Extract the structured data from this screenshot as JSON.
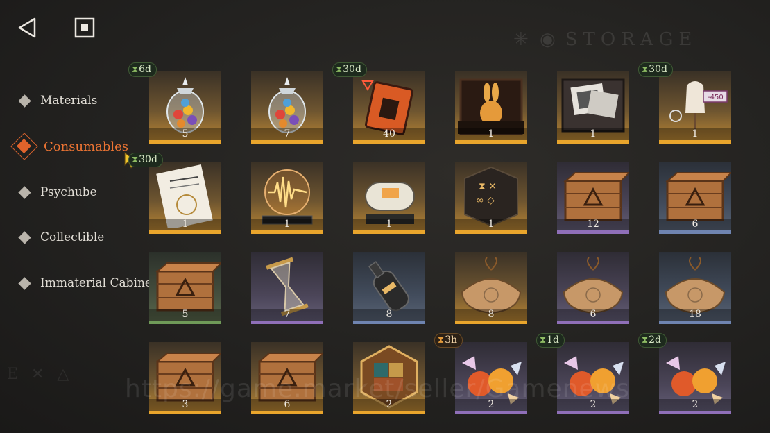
{
  "header": {
    "title": "STORAGE",
    "back_icon": "back-triangle-icon",
    "stop_icon": "stop-square-icon"
  },
  "sidebar": {
    "items": [
      {
        "label": "Materials",
        "active": false
      },
      {
        "label": "Consumables",
        "active": true
      },
      {
        "label": "Psychube",
        "active": false
      },
      {
        "label": "Collectible",
        "active": false
      },
      {
        "label": "Immaterial Cabinet",
        "active": false
      }
    ]
  },
  "colors": {
    "accent": "#e0632b",
    "rarity_gold": "#e9a52c",
    "rarity_purple": "#8f6fb8",
    "rarity_blue": "#6f84b0",
    "rarity_green": "#6f9a58",
    "timer_green": "#8dbb63",
    "timer_orange": "#e39a3b"
  },
  "items": [
    {
      "icon": "candy-jar-icon",
      "count": "5",
      "rarity": "gold",
      "timer": "6d",
      "timer_color": "green"
    },
    {
      "icon": "candy-jar-icon",
      "count": "7",
      "rarity": "gold",
      "timer": null
    },
    {
      "icon": "orange-book-icon",
      "count": "40",
      "rarity": "gold",
      "timer": "30d",
      "timer_color": "green"
    },
    {
      "icon": "golden-rabbit-box-icon",
      "count": "1",
      "rarity": "gold",
      "timer": null
    },
    {
      "icon": "photo-suitcase-icon",
      "count": "1",
      "rarity": "gold",
      "timer": null
    },
    {
      "icon": "mannequin-price-tag-icon",
      "count": "1",
      "rarity": "gold",
      "timer": "30d",
      "timer_color": "green"
    },
    {
      "icon": "ticket-note-icon",
      "count": "1",
      "rarity": "gold",
      "timer": "30d",
      "timer_color": "green"
    },
    {
      "icon": "sound-wave-orb-icon",
      "count": "1",
      "rarity": "gold",
      "timer": null
    },
    {
      "icon": "capsule-machine-icon",
      "count": "1",
      "rarity": "gold",
      "timer": null
    },
    {
      "icon": "rune-cube-icon",
      "count": "1",
      "rarity": "gold",
      "timer": null
    },
    {
      "icon": "wooden-crate-icon",
      "count": "12",
      "rarity": "purple",
      "timer": null
    },
    {
      "icon": "wooden-crate-icon",
      "count": "6",
      "rarity": "blue",
      "timer": null
    },
    {
      "icon": "wooden-crate-icon",
      "count": "5",
      "rarity": "green",
      "timer": null
    },
    {
      "icon": "hourglass-icon",
      "count": "7",
      "rarity": "purple",
      "timer": null
    },
    {
      "icon": "message-bottle-icon",
      "count": "8",
      "rarity": "blue",
      "timer": null
    },
    {
      "icon": "cloth-bundle-icon",
      "count": "8",
      "rarity": "gold",
      "timer": null
    },
    {
      "icon": "cloth-bundle-icon",
      "count": "6",
      "rarity": "purple",
      "timer": null
    },
    {
      "icon": "cloth-bundle-icon",
      "count": "18",
      "rarity": "blue",
      "timer": null
    },
    {
      "icon": "wooden-crate-icon",
      "count": "3",
      "rarity": "gold",
      "timer": null
    },
    {
      "icon": "wooden-crate-icon",
      "count": "6",
      "rarity": "gold",
      "timer": null
    },
    {
      "icon": "hexagon-puzzle-icon",
      "count": "2",
      "rarity": "gold",
      "timer": null
    },
    {
      "icon": "fruit-candy-icon",
      "count": "2",
      "rarity": "purple",
      "timer": "3h",
      "timer_color": "orange"
    },
    {
      "icon": "fruit-candy-icon",
      "count": "2",
      "rarity": "purple",
      "timer": "1d",
      "timer_color": "green"
    },
    {
      "icon": "fruit-candy-icon",
      "count": "2",
      "rarity": "purple",
      "timer": "2d",
      "timer_color": "green"
    }
  ],
  "watermark": "https://game.market/seller/Gamenews"
}
